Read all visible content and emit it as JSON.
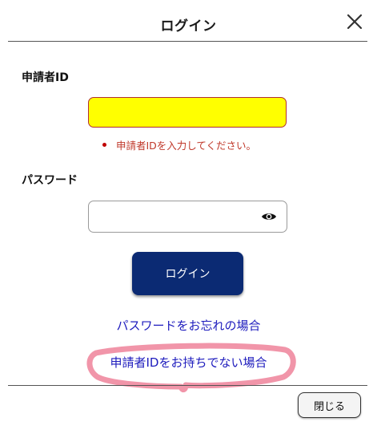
{
  "dialog": {
    "title": "ログイン",
    "close_icon": "close-icon"
  },
  "form": {
    "applicant_id": {
      "label": "申請者ID",
      "value": "",
      "error": "申請者IDを入力してください。",
      "highlight_color": "#ffff00",
      "error_color": "#c0392b"
    },
    "password": {
      "label": "パスワード",
      "value": "",
      "toggle_icon": "eye-icon"
    },
    "login_button": "ログイン",
    "login_button_color": "#0b2a73"
  },
  "links": {
    "forgot_password": "パスワードをお忘れの場合",
    "no_applicant_id": "申請者IDをお持ちでない場合",
    "link_color": "#1d1bbd"
  },
  "footer": {
    "close_button": "閉じる"
  },
  "annotation": {
    "type": "hand-drawn circle",
    "color": "#f08aa0"
  }
}
